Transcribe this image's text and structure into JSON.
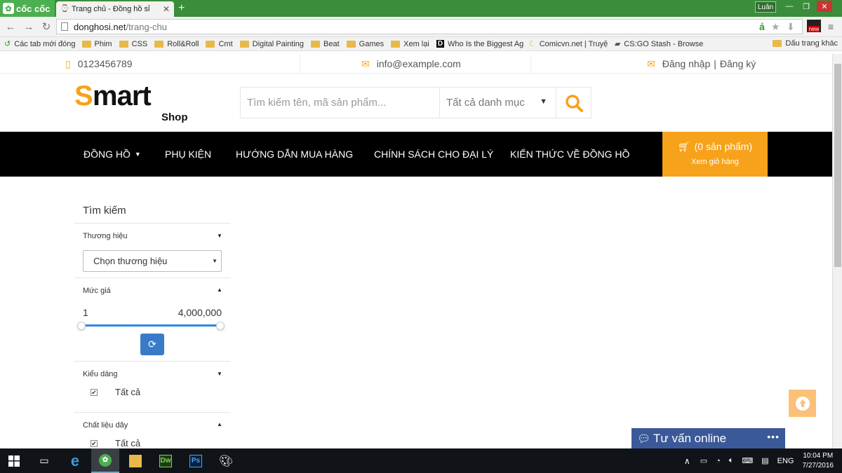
{
  "browser": {
    "brand": "cốc cốc",
    "tab_title": "Trang chủ - Đồng hồ sỉ",
    "user": "Luân",
    "url_host": "donghosi.net",
    "url_path": "/trang-chu",
    "bookmarks": [
      "Các tab mới đóng",
      "Phim",
      "CSS",
      "Roll&Roll",
      "Cmt",
      "Digital Painting",
      "Beat",
      "Games",
      "Xem lại",
      "Who Is the Biggest Ag",
      "Comicvn.net | Truyện",
      "CS:GO Stash - Browse"
    ],
    "other_bookmarks": "Dấu trang khác",
    "new_badge": "new"
  },
  "topinfo": {
    "phone": "0123456789",
    "email": "info@example.com",
    "login": "Đăng nhập",
    "separator": "|",
    "register": "Đăng ký"
  },
  "logo": {
    "s": "S",
    "mart": "mart",
    "shop": "Shop"
  },
  "search": {
    "placeholder": "Tìm kiếm tên, mã sản phẩm...",
    "category": "Tất cả danh mục"
  },
  "nav": {
    "items": [
      "ĐỒNG HỒ",
      "PHỤ KIỆN",
      "HƯỚNG DẪN MUA HÀNG",
      "CHÍNH SÁCH CHO ĐẠI LÝ",
      "KIẾN THỨC VỀ ĐỒNG HỒ"
    ]
  },
  "cart": {
    "count_label": "(0 sản phẩm)",
    "view_label": "Xem giỏ hàng"
  },
  "sidebar": {
    "title": "Tìm kiếm",
    "brand": {
      "label": "Thương hiệu",
      "select_value": "Chọn thương hiệu"
    },
    "price": {
      "label": "Mức giá",
      "min": "1",
      "max": "4,000,000",
      "range_fraction": [
        0.0,
        1.0
      ]
    },
    "style": {
      "label": "Kiểu dáng",
      "option": "Tất cả"
    },
    "strap": {
      "label": "Chất liệu dây",
      "option": "Tất cả"
    }
  },
  "chat": {
    "label": "Tư vấn online"
  },
  "taskbar": {
    "lang": "ENG",
    "time": "10:04 PM",
    "date": "7/27/2016"
  },
  "colors": {
    "accent": "#f7a21b",
    "navbar": "#000000",
    "chat": "#3b5998",
    "refresh": "#3a7bc8"
  }
}
